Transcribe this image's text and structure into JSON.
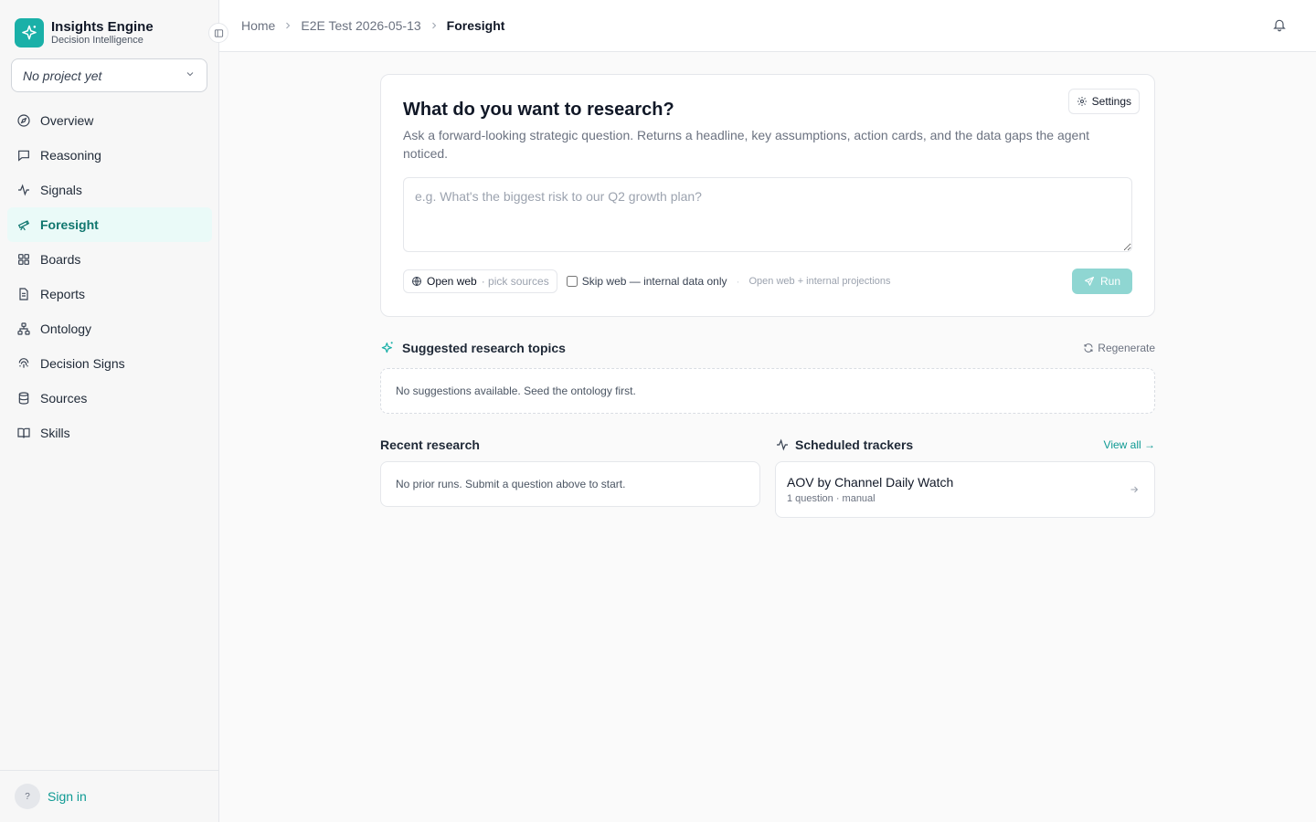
{
  "brand": {
    "title": "Insights Engine",
    "subtitle": "Decision Intelligence",
    "accent": "#1ab0a8"
  },
  "project_select": {
    "value": "No project yet"
  },
  "sidebar": {
    "items": [
      {
        "label": "Overview",
        "icon": "compass-icon",
        "active": false
      },
      {
        "label": "Reasoning",
        "icon": "message-square-icon",
        "active": false
      },
      {
        "label": "Signals",
        "icon": "activity-icon",
        "active": false
      },
      {
        "label": "Foresight",
        "icon": "telescope-icon",
        "active": true
      },
      {
        "label": "Boards",
        "icon": "grid-icon",
        "active": false
      },
      {
        "label": "Reports",
        "icon": "file-text-icon",
        "active": false
      },
      {
        "label": "Ontology",
        "icon": "network-icon",
        "active": false
      },
      {
        "label": "Decision Signs",
        "icon": "fingerprint-icon",
        "active": false
      },
      {
        "label": "Sources",
        "icon": "database-icon",
        "active": false
      },
      {
        "label": "Skills",
        "icon": "book-open-icon",
        "active": false
      }
    ],
    "footer": {
      "avatar": "?",
      "signin": "Sign in"
    }
  },
  "breadcrumb": {
    "items": [
      "Home",
      "E2E Test 2026-05-13"
    ],
    "current": "Foresight"
  },
  "research": {
    "title": "What do you want to research?",
    "description": "Ask a forward-looking strategic question. Returns a headline, key assumptions, action cards, and the data gaps the agent noticed.",
    "settings_label": "Settings",
    "placeholder": "e.g. What's the biggest risk to our Q2 growth plan?",
    "open_web_label": "Open web",
    "pick_sources": "· pick sources",
    "skip_web_label": "Skip web — internal data only",
    "hint": "Open web + internal projections",
    "run_label": "Run"
  },
  "suggestions": {
    "title": "Suggested research topics",
    "regenerate": "Regenerate",
    "empty": "No suggestions available. Seed the ontology first."
  },
  "recent": {
    "title": "Recent research",
    "empty": "No prior runs. Submit a question above to start."
  },
  "trackers": {
    "title": "Scheduled trackers",
    "view_all": "View all →",
    "items": [
      {
        "name": "AOV by Channel Daily Watch",
        "meta": "1 question · manual"
      }
    ]
  }
}
